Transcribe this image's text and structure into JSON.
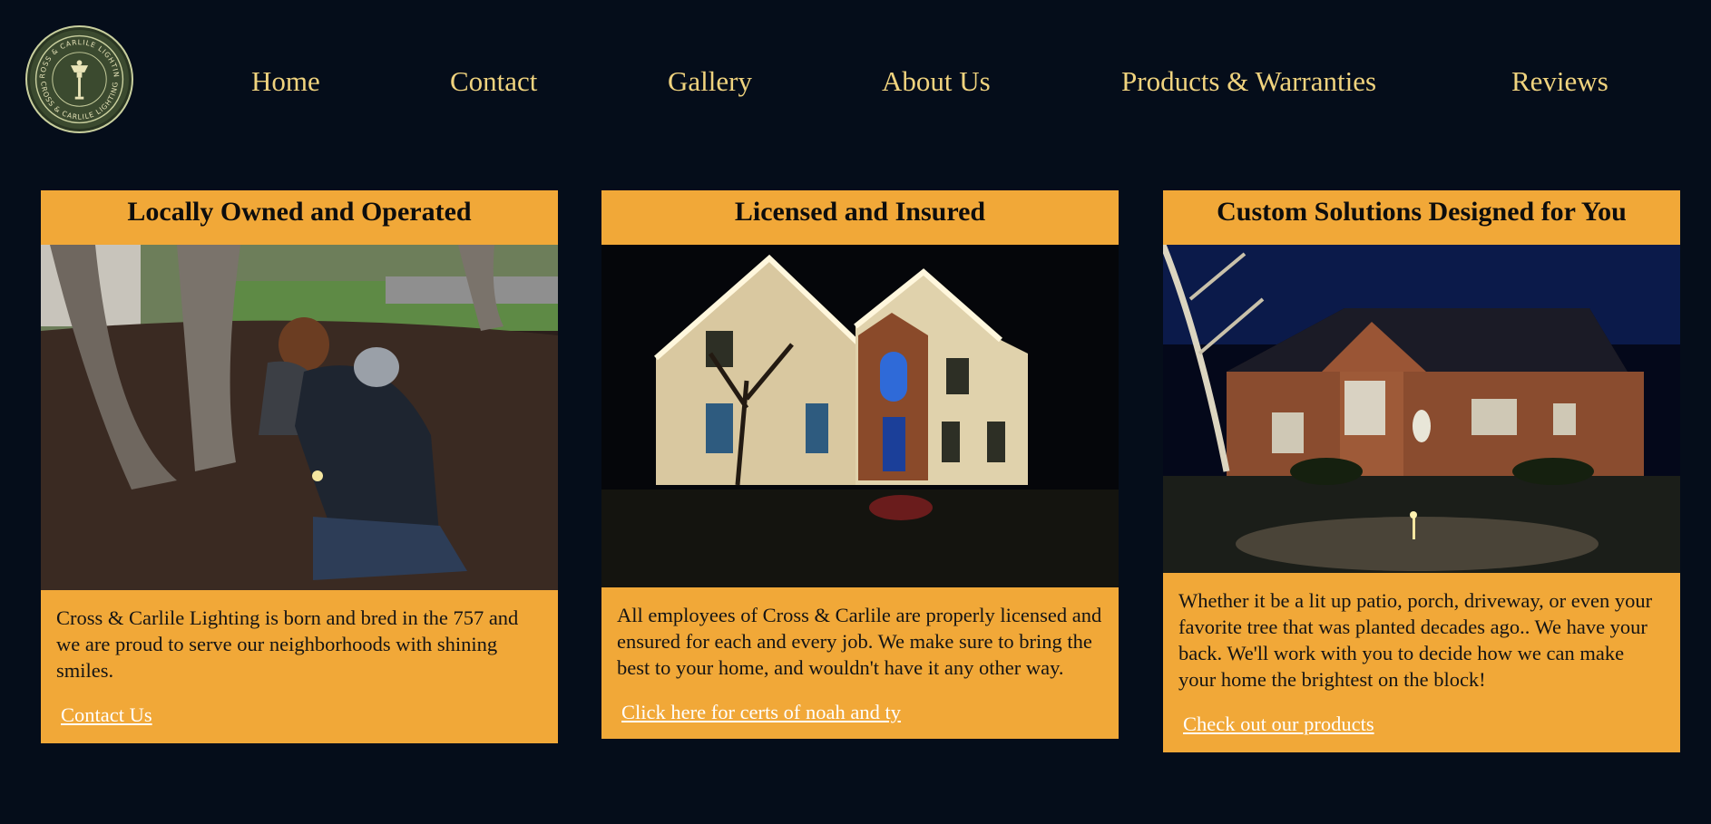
{
  "logo": {
    "text": "CROSS & CARLILE LIGHTING",
    "icon": "lamp-post-icon",
    "colors": {
      "background": "#3b4a2f",
      "ring": "#c9cf9e"
    }
  },
  "nav": {
    "items": [
      {
        "label": "Home"
      },
      {
        "label": "Contact"
      },
      {
        "label": "Gallery"
      },
      {
        "label": "About Us"
      },
      {
        "label": "Products & Warranties"
      },
      {
        "label": "Reviews"
      }
    ]
  },
  "cards": [
    {
      "title": "Locally Owned and Operated",
      "image": "photo of two people installing landscape lighting in a mulched yard",
      "text": "Cross & Carlile Lighting is born and bred in the 757 and we are proud to serve our neighborhoods with shining smiles.",
      "link": "Contact Us"
    },
    {
      "title": "Licensed and Insured",
      "image": "night photo of a two-story house lit with roofline and landscape lighting",
      "text": "All employees of Cross & Carlile are properly licensed and ensured for each and every job. We make sure to bring the best to your home, and wouldn't have it any other way.",
      "link": "Click here for certs of noah and ty"
    },
    {
      "title": "Custom Solutions Designed for You",
      "image": "night photo of a brick ranch home with uplights and path lights",
      "text": "Whether it be a lit up patio, porch, driveway, or even your favorite tree that was planted decades ago.. We have your back. We'll work with you to decide how we can make your home the brightest on the block!",
      "link": "Check out our products"
    }
  ],
  "colors": {
    "page_background": "#050d1a",
    "nav_text": "#f0d37e",
    "card_background": "#f1a838",
    "link_text": "#ffffff"
  }
}
